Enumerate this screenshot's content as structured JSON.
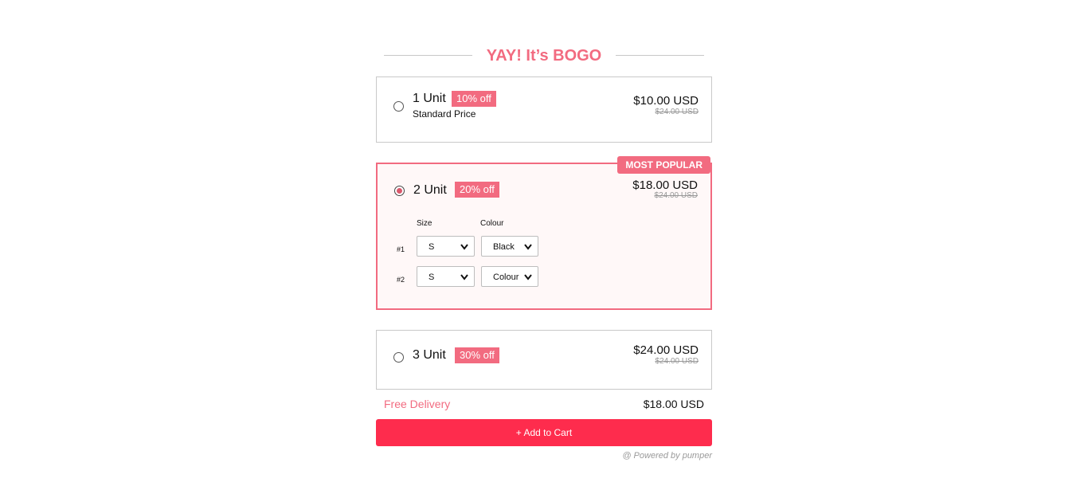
{
  "heading": {
    "title": "YAY! It’s BOGO"
  },
  "offers": [
    {
      "unit": "1 Unit",
      "badge": "10% off",
      "subtitle": "Standard Price",
      "price": "$10.00 USD",
      "old_price": "$24.00 USD",
      "selected": false
    },
    {
      "unit": "2 Unit",
      "badge": "20% off",
      "price": "$18.00 USD",
      "old_price": "$24.00 USD",
      "selected": true,
      "tag": "MOST POPULAR",
      "variant_headers": {
        "size": "Size",
        "colour": "Colour"
      },
      "variants": [
        {
          "index": "#1",
          "size": "S",
          "colour": "Black"
        },
        {
          "index": "#2",
          "size": "S",
          "colour": "Colour"
        }
      ]
    },
    {
      "unit": "3 Unit",
      "badge": "30% off",
      "price": "$24.00 USD",
      "old_price": "$24.00 USD",
      "selected": false
    }
  ],
  "footer": {
    "free_delivery": "Free Delivery",
    "total": "$18.00 USD"
  },
  "cart_button": "+ Add to Cart",
  "powered_by": "@ Powered by pumper",
  "colors": {
    "accent": "#f26b80",
    "cart": "#fe2c4d"
  }
}
